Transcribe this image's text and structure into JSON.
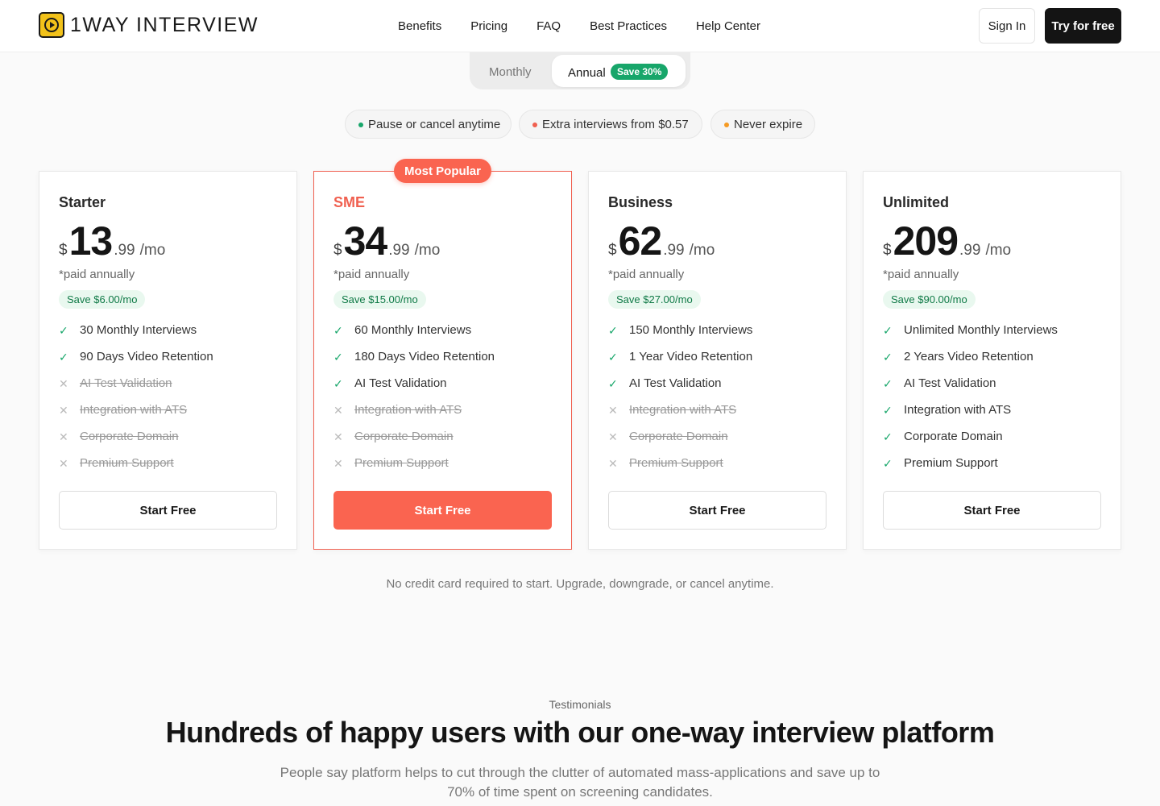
{
  "header": {
    "logo_text": "1WAY INTERVIEW",
    "nav": [
      "Benefits",
      "Pricing",
      "FAQ",
      "Best Practices",
      "Help Center"
    ],
    "sign_in": "Sign In",
    "try_free": "Try for free"
  },
  "billing": {
    "monthly": "Monthly",
    "annual": "Annual",
    "annual_save": "Save 30%",
    "selected": "Annual"
  },
  "perks": [
    {
      "label": "Pause or cancel anytime",
      "dot_color": "#17a66a"
    },
    {
      "label": "Extra interviews from $0.57",
      "dot_color": "#f06050"
    },
    {
      "label": "Never expire",
      "dot_color": "#f59a23"
    }
  ],
  "popular_badge": "Most Popular",
  "plans": [
    {
      "name": "Starter",
      "currency": "$",
      "amount": "13",
      "cents": ".99",
      "period": "/mo",
      "paid_note": "*paid annually",
      "save": "Save $6.00/mo",
      "features": [
        {
          "label": "30 Monthly Interviews",
          "included": true
        },
        {
          "label": "90 Days Video Retention",
          "included": true
        },
        {
          "label": "AI Test Validation",
          "included": false
        },
        {
          "label": "Integration with ATS",
          "included": false
        },
        {
          "label": "Corporate Domain",
          "included": false
        },
        {
          "label": "Premium Support",
          "included": false
        }
      ],
      "cta": "Start Free"
    },
    {
      "name": "SME",
      "currency": "$",
      "amount": "34",
      "cents": ".99",
      "period": "/mo",
      "paid_note": "*paid annually",
      "save": "Save $15.00/mo",
      "features": [
        {
          "label": "60 Monthly Interviews",
          "included": true
        },
        {
          "label": "180 Days Video Retention",
          "included": true
        },
        {
          "label": "AI Test Validation",
          "included": true
        },
        {
          "label": "Integration with ATS",
          "included": false
        },
        {
          "label": "Corporate Domain",
          "included": false
        },
        {
          "label": "Premium Support",
          "included": false
        }
      ],
      "cta": "Start Free"
    },
    {
      "name": "Business",
      "currency": "$",
      "amount": "62",
      "cents": ".99",
      "period": "/mo",
      "paid_note": "*paid annually",
      "save": "Save $27.00/mo",
      "features": [
        {
          "label": "150 Monthly Interviews",
          "included": true
        },
        {
          "label": "1 Year Video Retention",
          "included": true
        },
        {
          "label": "AI Test Validation",
          "included": true
        },
        {
          "label": "Integration with ATS",
          "included": false
        },
        {
          "label": "Corporate Domain",
          "included": false
        },
        {
          "label": "Premium Support",
          "included": false
        }
      ],
      "cta": "Start Free"
    },
    {
      "name": "Unlimited",
      "currency": "$",
      "amount": "209",
      "cents": ".99",
      "period": "/mo",
      "paid_note": "*paid annually",
      "save": "Save $90.00/mo",
      "features": [
        {
          "label": "Unlimited Monthly Interviews",
          "included": true
        },
        {
          "label": "2 Years Video Retention",
          "included": true
        },
        {
          "label": "AI Test Validation",
          "included": true
        },
        {
          "label": "Integration with ATS",
          "included": true
        },
        {
          "label": "Corporate Domain",
          "included": true
        },
        {
          "label": "Premium Support",
          "included": true
        }
      ],
      "cta": "Start Free"
    }
  ],
  "pricing_note": "No credit card required to start. Upgrade, downgrade, or cancel anytime.",
  "testimonials": {
    "eyebrow": "Testimonials",
    "headline": "Hundreds of happy users with our one-way interview platform",
    "subtext": "People say platform helps to cut through the clutter of automated mass-applications and save up to 70% of time spent on screening candidates."
  },
  "colors": {
    "accent": "#fa6450",
    "success": "#17a66a",
    "dark": "#141414"
  }
}
